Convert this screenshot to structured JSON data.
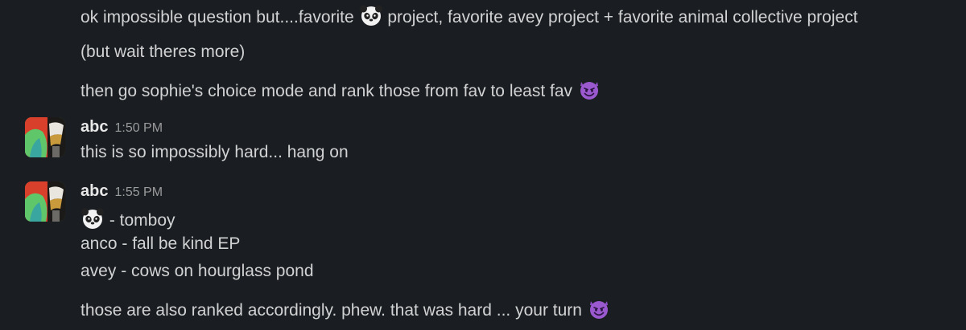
{
  "messages": {
    "m1_before": "ok impossible question but....favorite ",
    "m1_after": " project, favorite avey project + favorite animal collective project",
    "m1_emoji": "panda-face-icon",
    "m2": "(but wait theres more)",
    "m3": "then go sophie's choice mode and rank those from fav to least fav ",
    "m3_emoji": "smiling-imp-icon"
  },
  "posts": [
    {
      "author": "abc",
      "time": "1:50 PM",
      "lines": [
        "this is so impossibly hard... hang on"
      ]
    },
    {
      "author": "abc",
      "time": "1:55 PM",
      "line1_text": " - tomboy",
      "line1_emoji": "panda-face-icon",
      "line2": "anco - fall be kind EP",
      "line3": "avey - cows on hourglass pond",
      "line4": "those are also ranked accordingly. phew. that was hard ... your turn ",
      "line4_emoji": "smiling-imp-icon"
    }
  ],
  "colors": {
    "background": "#1a1d21",
    "text": "#d1d2d3",
    "timestamp": "#9a9b9c",
    "imp_purple": "#9b59d0"
  }
}
